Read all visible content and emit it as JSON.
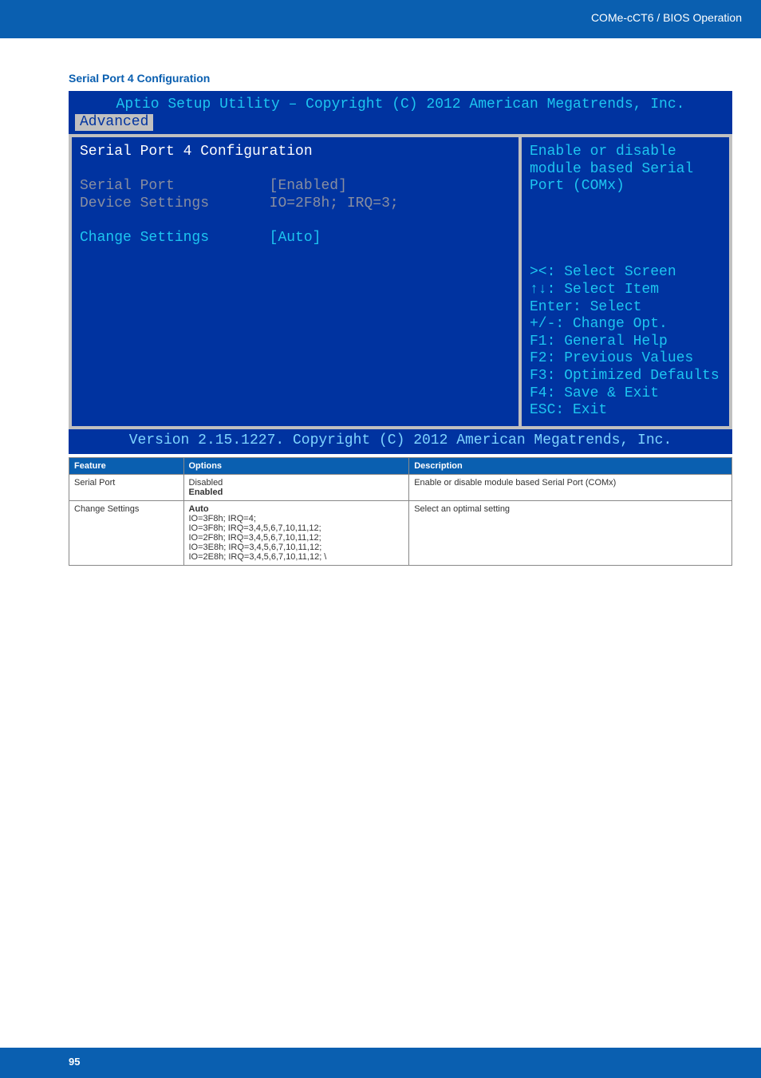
{
  "header": {
    "title": "COMe-cCT6 / BIOS Operation"
  },
  "section": {
    "title": "Serial Port 4 Configuration"
  },
  "bios": {
    "top": "Aptio Setup Utility – Copyright (C) 2012 American Megatrends, Inc.",
    "tab": "Advanced",
    "left_title": "Serial Port 4 Configuration",
    "rows": {
      "serial_port_label": "Serial Port",
      "serial_port_value": "[Enabled]",
      "device_settings_label": "Device Settings",
      "device_settings_value": "IO=2F8h; IRQ=3;",
      "change_settings_label": "Change Settings",
      "change_settings_value": "[Auto]"
    },
    "help": "Enable or disable\nmodule based Serial\nPort (COMx)",
    "keys": "><: Select Screen\n↑↓: Select Item\nEnter: Select\n+/-: Change Opt.\nF1: General Help\nF2: Previous Values\nF3: Optimized Defaults\nF4: Save & Exit\nESC: Exit",
    "bottom": "Version 2.15.1227. Copyright (C) 2012 American Megatrends, Inc."
  },
  "table": {
    "headers": {
      "feature": "Feature",
      "options": "Options",
      "description": "Description"
    },
    "rows": [
      {
        "feature": "Serial Port",
        "options": "Disabled\n<b>Enabled</b>",
        "description": "Enable or disable module based Serial Port (COMx)"
      },
      {
        "feature": "Change Settings",
        "options": "<b>Auto</b>\nIO=3F8h; IRQ=4;\nIO=3F8h; IRQ=3,4,5,6,7,10,11,12;\nIO=2F8h; IRQ=3,4,5,6,7,10,11,12;\nIO=3E8h; IRQ=3,4,5,6,7,10,11,12;\nIO=2E8h; IRQ=3,4,5,6,7,10,11,12; \\",
        "description": "Select an optimal setting"
      }
    ]
  },
  "footer": {
    "page": "95"
  }
}
